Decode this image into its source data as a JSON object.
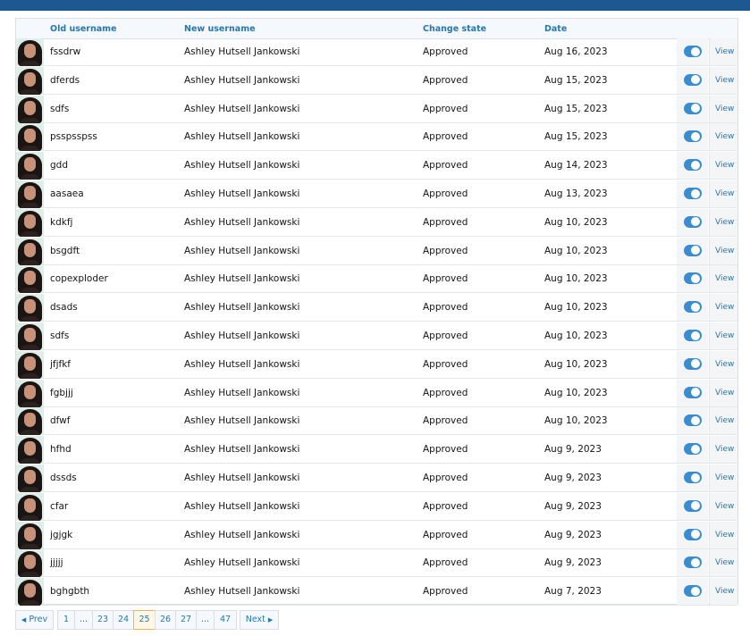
{
  "table": {
    "headers": {
      "old_username": "Old username",
      "new_username": "New username",
      "change_state": "Change state",
      "date": "Date"
    },
    "view_label": "View",
    "rows": [
      {
        "old": "fssdrw",
        "new": "Ashley Hutsell Jankowski",
        "state": "Approved",
        "date": "Aug 16, 2023",
        "toggle_on": true
      },
      {
        "old": "dferds",
        "new": "Ashley Hutsell Jankowski",
        "state": "Approved",
        "date": "Aug 15, 2023",
        "toggle_on": true
      },
      {
        "old": "sdfs",
        "new": "Ashley Hutsell Jankowski",
        "state": "Approved",
        "date": "Aug 15, 2023",
        "toggle_on": true
      },
      {
        "old": "psspsspss",
        "new": "Ashley Hutsell Jankowski",
        "state": "Approved",
        "date": "Aug 15, 2023",
        "toggle_on": true
      },
      {
        "old": "gdd",
        "new": "Ashley Hutsell Jankowski",
        "state": "Approved",
        "date": "Aug 14, 2023",
        "toggle_on": true
      },
      {
        "old": "aasaea",
        "new": "Ashley Hutsell Jankowski",
        "state": "Approved",
        "date": "Aug 13, 2023",
        "toggle_on": true
      },
      {
        "old": "kdkfj",
        "new": "Ashley Hutsell Jankowski",
        "state": "Approved",
        "date": "Aug 10, 2023",
        "toggle_on": true
      },
      {
        "old": "bsgdft",
        "new": "Ashley Hutsell Jankowski",
        "state": "Approved",
        "date": "Aug 10, 2023",
        "toggle_on": true
      },
      {
        "old": "copexploder",
        "new": "Ashley Hutsell Jankowski",
        "state": "Approved",
        "date": "Aug 10, 2023",
        "toggle_on": true
      },
      {
        "old": "dsads",
        "new": "Ashley Hutsell Jankowski",
        "state": "Approved",
        "date": "Aug 10, 2023",
        "toggle_on": true
      },
      {
        "old": "sdfs",
        "new": "Ashley Hutsell Jankowski",
        "state": "Approved",
        "date": "Aug 10, 2023",
        "toggle_on": true
      },
      {
        "old": "jfjfkf",
        "new": "Ashley Hutsell Jankowski",
        "state": "Approved",
        "date": "Aug 10, 2023",
        "toggle_on": true
      },
      {
        "old": "fgbjjj",
        "new": "Ashley Hutsell Jankowski",
        "state": "Approved",
        "date": "Aug 10, 2023",
        "toggle_on": true
      },
      {
        "old": "dfwf",
        "new": "Ashley Hutsell Jankowski",
        "state": "Approved",
        "date": "Aug 10, 2023",
        "toggle_on": true
      },
      {
        "old": "hfhd",
        "new": "Ashley Hutsell Jankowski",
        "state": "Approved",
        "date": "Aug 9, 2023",
        "toggle_on": true
      },
      {
        "old": "dssds",
        "new": "Ashley Hutsell Jankowski",
        "state": "Approved",
        "date": "Aug 9, 2023",
        "toggle_on": true
      },
      {
        "old": "cfar",
        "new": "Ashley Hutsell Jankowski",
        "state": "Approved",
        "date": "Aug 9, 2023",
        "toggle_on": true
      },
      {
        "old": "jgjgk",
        "new": "Ashley Hutsell Jankowski",
        "state": "Approved",
        "date": "Aug 9, 2023",
        "toggle_on": true
      },
      {
        "old": "jjjjj",
        "new": "Ashley Hutsell Jankowski",
        "state": "Approved",
        "date": "Aug 9, 2023",
        "toggle_on": true
      },
      {
        "old": "bghgbth",
        "new": "Ashley Hutsell Jankowski",
        "state": "Approved",
        "date": "Aug 7, 2023",
        "toggle_on": true
      }
    ]
  },
  "pagination": {
    "prev_label": "Prev",
    "next_label": "Next",
    "first_page": "1",
    "ellipsis": "...",
    "pages": [
      "23",
      "24",
      "25",
      "26",
      "27"
    ],
    "current_page": "25",
    "last_page": "47"
  },
  "colors": {
    "header_bar": "#1f5791",
    "link": "#2577b1",
    "toggle_on": "#3a8cd1",
    "current_page_bg": "#fef7e4"
  }
}
